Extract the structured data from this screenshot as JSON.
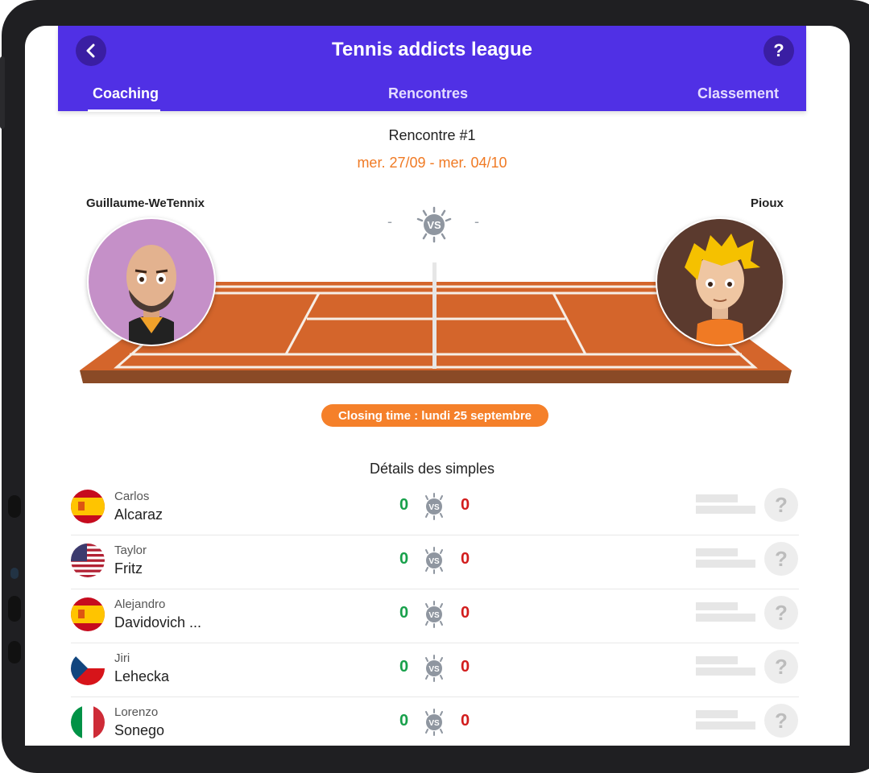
{
  "header": {
    "title": "Tennis addicts league",
    "back_icon": "chevron-left-icon",
    "help_label": "?",
    "background_color": "#5030e5"
  },
  "tabs": [
    {
      "label": "Coaching",
      "active": true
    },
    {
      "label": "Rencontres",
      "active": false
    },
    {
      "label": "Classement",
      "active": false
    }
  ],
  "match": {
    "title": "Rencontre #1",
    "dates": "mer. 27/09 - mer. 04/10",
    "player_left": "Guillaume-WeTennix",
    "player_right": "Pioux",
    "score_left": "-",
    "score_right": "-",
    "vs_label": "VS",
    "closing": "Closing time : lundi 25 septembre"
  },
  "details": {
    "title": "Détails des simples",
    "rows": [
      {
        "first": "Carlos",
        "last": "Alcaraz",
        "flag": "spain",
        "score_left": "0",
        "score_right": "0",
        "vs": "VS",
        "help": "?"
      },
      {
        "first": "Taylor",
        "last": "Fritz",
        "flag": "usa",
        "score_left": "0",
        "score_right": "0",
        "vs": "VS",
        "help": "?"
      },
      {
        "first": "Alejandro",
        "last": "Davidovich ...",
        "flag": "spain",
        "score_left": "0",
        "score_right": "0",
        "vs": "VS",
        "help": "?"
      },
      {
        "first": "Jiri",
        "last": "Lehecka",
        "flag": "czechia",
        "score_left": "0",
        "score_right": "0",
        "vs": "VS",
        "help": "?"
      },
      {
        "first": "Lorenzo",
        "last": "Sonego",
        "flag": "italy",
        "score_left": "0",
        "score_right": "0",
        "vs": "VS",
        "help": "?"
      }
    ]
  },
  "colors": {
    "accent": "#5030e5",
    "orange": "#f5802a",
    "win_green": "#17a04a",
    "lose_red": "#d21c1c",
    "court": "#d4652b"
  }
}
